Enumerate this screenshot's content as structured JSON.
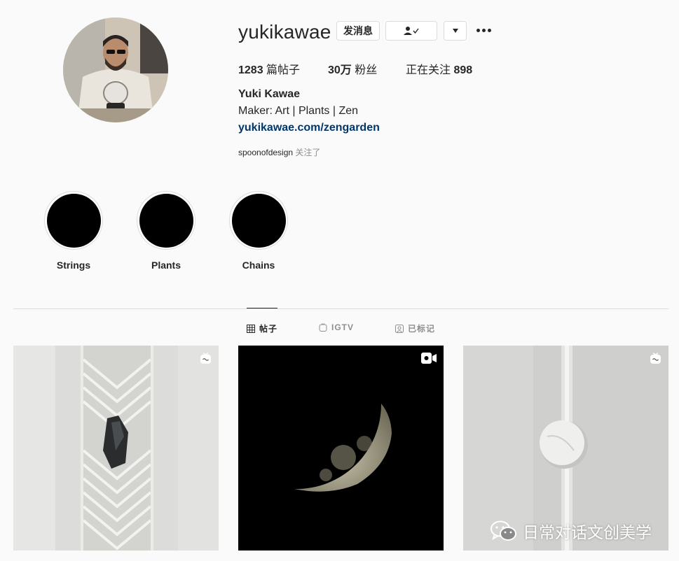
{
  "profile": {
    "username": "yukikawae",
    "message_button": "发消息",
    "posts_count": "1283",
    "posts_label": "篇帖子",
    "followers_count": "30万",
    "followers_label": "粉丝",
    "following_label": "正在关注",
    "following_count": "898",
    "full_name": "Yuki Kawae",
    "bio": "Maker: Art | Plants | Zen",
    "link": "yukikawae.com/zengarden",
    "followed_by_user": "spoonofdesign",
    "followed_by_text": "关注了"
  },
  "highlights": [
    {
      "label": "Strings"
    },
    {
      "label": "Plants"
    },
    {
      "label": "Chains"
    }
  ],
  "tabs": [
    {
      "label": "帖子",
      "icon": "grid-icon",
      "active": true
    },
    {
      "label": "IGTV",
      "icon": "igtv-icon",
      "active": false
    },
    {
      "label": "已标记",
      "icon": "tagged-icon",
      "active": false
    }
  ],
  "posts": [
    {
      "subject": "zen sand pattern with rock",
      "badge": "igtv-icon"
    },
    {
      "subject": "half moon on black",
      "badge": "video-icon"
    },
    {
      "subject": "marble disc on sand groove",
      "badge": "igtv-icon"
    }
  ],
  "watermark": "日常对话文创美学",
  "colors": {
    "link": "#00376b",
    "text": "#262626",
    "muted": "#8e8e8e",
    "border": "#dbdbdb",
    "background": "#fafafa"
  }
}
